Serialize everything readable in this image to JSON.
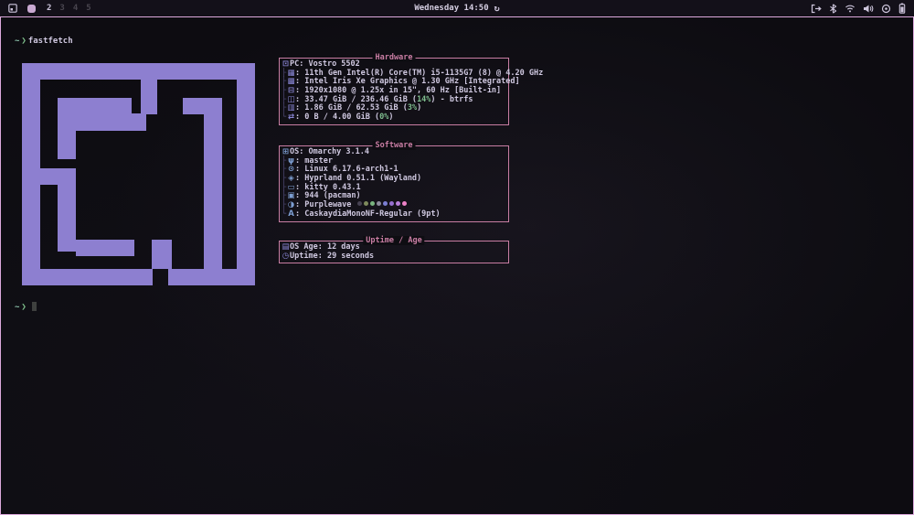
{
  "colors": {
    "logo_purple": "#8d7fd0",
    "box_pink": "#c87da3",
    "percent_green": "#7fbf8f",
    "foreground": "#cfc8e0",
    "window_border": "#dca9dc",
    "theme_dots": [
      "#474253",
      "#7d8a5c",
      "#79b37f",
      "#8c8a9c",
      "#7b7ed2",
      "#966fd0",
      "#b77fd9",
      "#ee82c8"
    ]
  },
  "topbar": {
    "workspaces": [
      "2",
      "3",
      "4",
      "5"
    ],
    "clock": "Wednesday 14:50",
    "refresh_icon": "↻"
  },
  "terminal": {
    "prompt": {
      "cwd": "~",
      "symbol": "❯",
      "command": "fastfetch"
    },
    "prompt2": {
      "cwd": "~",
      "symbol": "❯"
    },
    "sections": [
      {
        "id": "hardware",
        "title": "Hardware",
        "rows": [
          {
            "icon": "⊡",
            "icon_name": "pc-icon",
            "label": "PC:",
            "segs": [
              {
                "t": " Vostro 5502"
              }
            ]
          },
          {
            "tree": "├",
            "icon": "▦",
            "icon_name": "cpu-icon",
            "segs": [
              {
                "t": ": 11th Gen Intel(R) Core(TM) i5-1135G7 (8) @ 4.20 GHz"
              }
            ]
          },
          {
            "tree": "├",
            "icon": "▩",
            "icon_name": "gpu-icon",
            "segs": [
              {
                "t": ": Intel Iris Xe Graphics @ 1.30 GHz [Integrated]"
              }
            ]
          },
          {
            "tree": "├",
            "icon": "⊟",
            "icon_name": "display-icon",
            "segs": [
              {
                "t": ": 1920x1080 @ 1.25x in 15\", 60 Hz [Built-in]"
              }
            ]
          },
          {
            "tree": "├",
            "icon": "◫",
            "icon_name": "disk-icon",
            "segs": [
              {
                "t": ": 33.47 GiB / 236.46 GiB ("
              },
              {
                "t": "14%",
                "c": "green"
              },
              {
                "t": ") - btrfs"
              }
            ]
          },
          {
            "tree": "├",
            "icon": "▥",
            "icon_name": "memory-icon",
            "segs": [
              {
                "t": ": 1.86 GiB / 62.53 GiB ("
              },
              {
                "t": "3%",
                "c": "green"
              },
              {
                "t": ")"
              }
            ]
          },
          {
            "tree": "└",
            "icon": "⇄",
            "icon_name": "swap-icon",
            "segs": [
              {
                "t": ": 0 B / 4.00 GiB ("
              },
              {
                "t": "0%",
                "c": "green"
              },
              {
                "t": ")"
              }
            ]
          }
        ]
      },
      {
        "id": "software",
        "title": "Software",
        "rows": [
          {
            "icon": "⊞",
            "icon_name": "os-icon",
            "label": "OS:",
            "segs": [
              {
                "t": " Omarchy 3.1.4"
              }
            ]
          },
          {
            "tree": "├",
            "icon": "ψ",
            "icon_name": "git-branch-icon",
            "segs": [
              {
                "t": ": master"
              }
            ]
          },
          {
            "tree": "├",
            "icon": "⊙",
            "icon_name": "kernel-icon",
            "segs": [
              {
                "t": ": Linux 6.17.6-arch1-1"
              }
            ]
          },
          {
            "tree": "├",
            "icon": "◈",
            "icon_name": "wm-icon",
            "segs": [
              {
                "t": ": Hyprland 0.51.1 (Wayland)"
              }
            ]
          },
          {
            "tree": "├",
            "icon": "▭",
            "icon_name": "terminal-icon",
            "segs": [
              {
                "t": ": kitty 0.43.1"
              }
            ]
          },
          {
            "tree": "├",
            "icon": "▣",
            "icon_name": "packages-icon",
            "segs": [
              {
                "t": ": 944 (pacman)"
              }
            ]
          },
          {
            "tree": "├",
            "icon": "◑",
            "icon_name": "theme-icon",
            "segs": [
              {
                "t": ": Purplewave "
              },
              {
                "dot": "#474253"
              },
              {
                "dot": "#7d8a5c"
              },
              {
                "dot": "#79b37f"
              },
              {
                "dot": "#8c8a9c"
              },
              {
                "dot": "#7b7ed2"
              },
              {
                "dot": "#966fd0"
              },
              {
                "dot": "#b77fd9"
              },
              {
                "dot": "#ee82c8"
              }
            ]
          },
          {
            "tree": "└",
            "icon": "A",
            "icon_name": "font-icon",
            "segs": [
              {
                "t": ": CaskaydiaMonoNF-Regular (9pt)"
              }
            ]
          }
        ]
      },
      {
        "id": "uptime-age",
        "title": "Uptime / Age",
        "rows": [
          {
            "icon": "▤",
            "icon_name": "calendar-icon",
            "label": "OS Age:",
            "segs": [
              {
                "t": " 12 days"
              }
            ]
          },
          {
            "icon": "◷",
            "icon_name": "clock-icon",
            "label": "Uptime:",
            "segs": [
              {
                "t": " 29 seconds"
              }
            ]
          }
        ]
      }
    ]
  }
}
